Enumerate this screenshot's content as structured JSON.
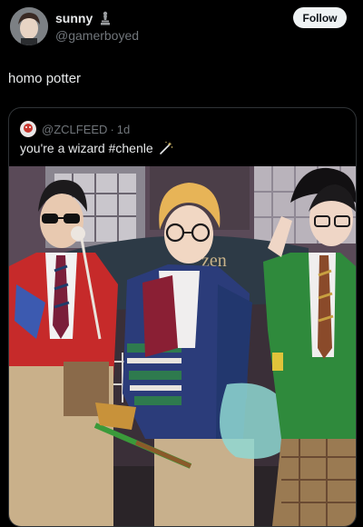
{
  "post": {
    "display_name": "sunny",
    "handle": "@gamerboyed",
    "follow_label": "Follow",
    "text": "homo potter"
  },
  "quote": {
    "handle": "@ZCLFEED",
    "separator": "·",
    "time": "1d",
    "text": "you're a wizard #chenle"
  },
  "photo": {
    "banner_text": "zen"
  },
  "icons": {
    "badge": "chess-piece-icon",
    "wand": "magic-wand-icon"
  }
}
